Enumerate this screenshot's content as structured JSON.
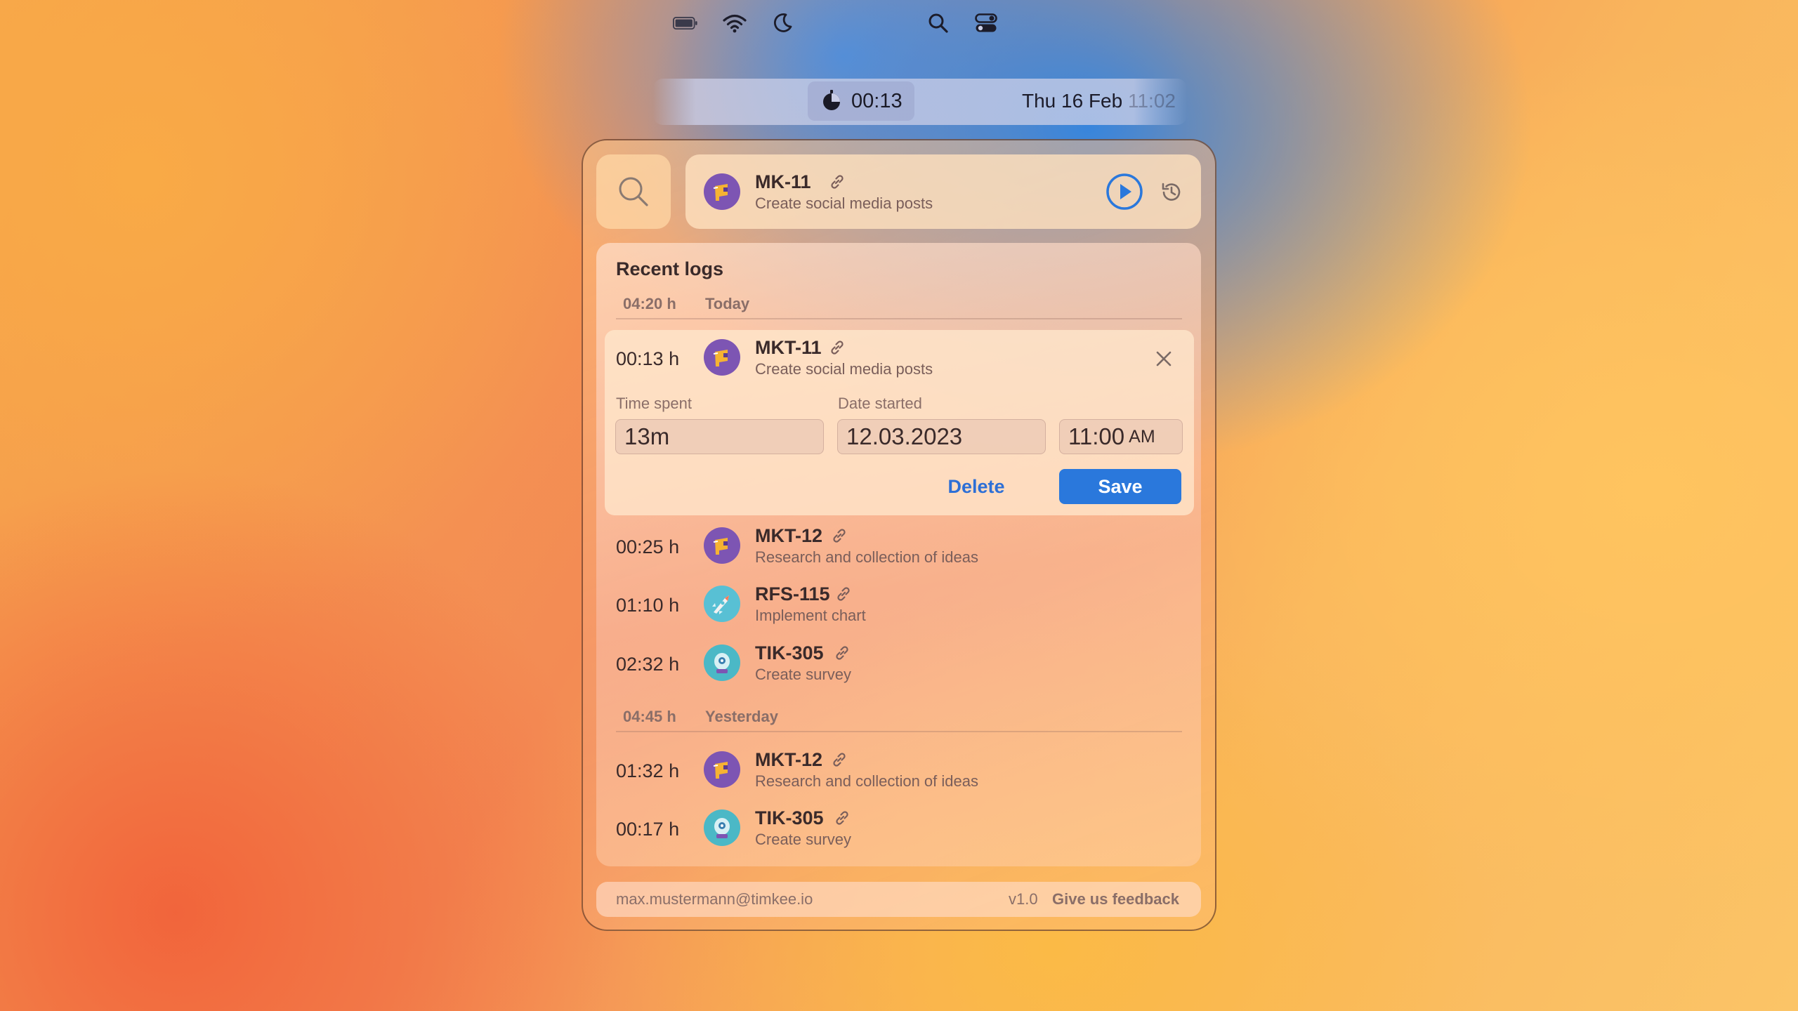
{
  "menubar": {
    "icons": [
      "battery-icon",
      "wifi-icon",
      "moon-icon",
      "timer-icon",
      "search-icon",
      "control-center-icon"
    ],
    "timer": "00:13",
    "date": "Thu 16 Feb",
    "time": "11:02"
  },
  "current": {
    "code": "MK-11",
    "description": "Create social media posts"
  },
  "logs": {
    "title": "Recent logs",
    "groups": [
      {
        "total": "04:20 h",
        "label": "Today",
        "entries": [
          {
            "duration": "00:13 h",
            "code": "MKT-11",
            "description": "Create social media posts"
          },
          {
            "duration": "00:25 h",
            "code": "MKT-12",
            "description": "Research and collection of ideas"
          },
          {
            "duration": "01:10 h",
            "code": "RFS-115",
            "description": "Implement chart"
          },
          {
            "duration": "02:32 h",
            "code": "TIK-305",
            "description": "Create survey"
          }
        ]
      },
      {
        "total": "04:45 h",
        "label": "Yesterday",
        "entries": [
          {
            "duration": "01:32 h",
            "code": "MKT-12",
            "description": "Research and collection of ideas"
          },
          {
            "duration": "00:17 h",
            "code": "TIK-305",
            "description": "Create survey"
          }
        ]
      }
    ]
  },
  "editor": {
    "time_spent_label": "Time spent",
    "time_spent_value": "13m",
    "date_started_label": "Date started",
    "date_value": "12.03.2023",
    "time_value": "11:00",
    "ampm": "AM",
    "delete_label": "Delete",
    "save_label": "Save"
  },
  "footer": {
    "email": "max.mustermann@timkee.io",
    "version": "v1.0",
    "feedback": "Give us feedback"
  },
  "colors": {
    "accent": "#2a78dc",
    "text": "#3a2a2a",
    "muted": "#8a6e68"
  }
}
